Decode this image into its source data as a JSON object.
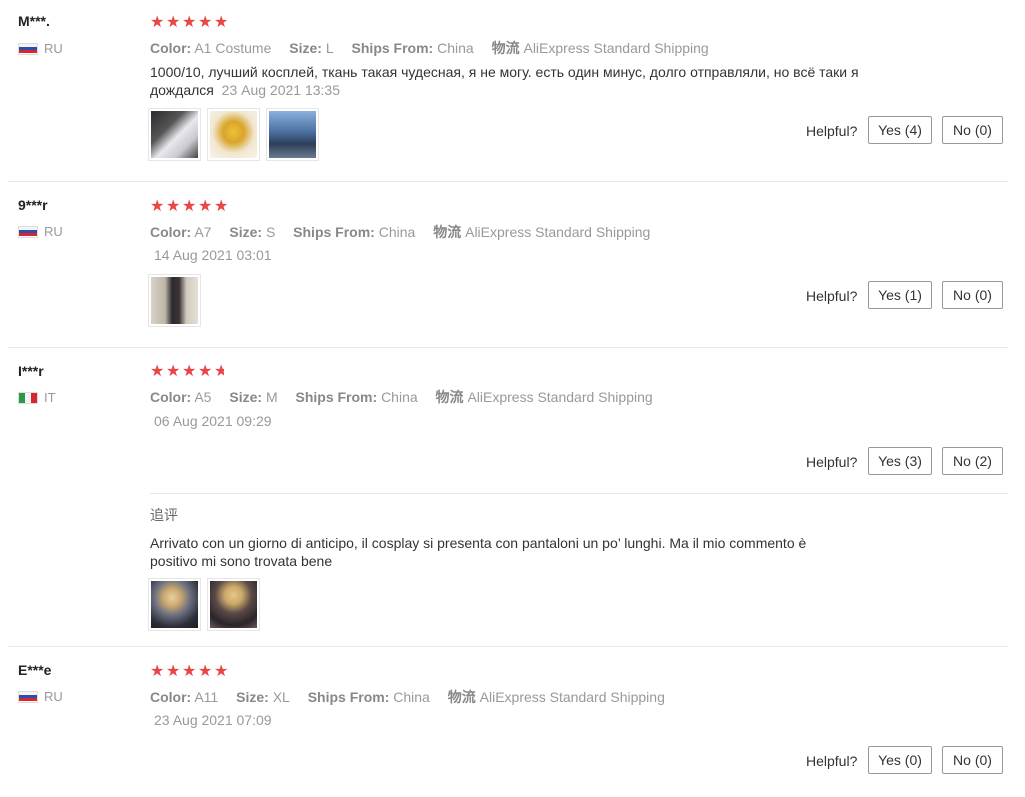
{
  "labels": {
    "color": "Color:",
    "size": "Size:",
    "ships_from": "Ships From:",
    "shipping_label": "物流",
    "helpful": "Helpful?",
    "followup": "追评"
  },
  "star_color": "#e84545",
  "reviews": [
    {
      "user": "M***.",
      "country": "RU",
      "rating": 5,
      "color": "A1 Costume",
      "size": "L",
      "ships_from": "China",
      "shipping": "AliExpress Standard Shipping",
      "text": "1000/10, лучший косплей, ткань такая чудесная, я не могу. есть один минус, долго отправляли, но всё таки я дождался",
      "date": "23 Aug 2021 13:35",
      "yes": "Yes (4)",
      "no": "No (0)"
    },
    {
      "user": "9***r",
      "country": "RU",
      "rating": 5,
      "color": "A7",
      "size": "S",
      "ships_from": "China",
      "shipping": "AliExpress Standard Shipping",
      "date": "14 Aug 2021 03:01",
      "yes": "Yes (1)",
      "no": "No (0)"
    },
    {
      "user": "I***r",
      "country": "IT",
      "rating": 4.7,
      "color": "A5",
      "size": "M",
      "ships_from": "China",
      "shipping": "AliExpress Standard Shipping",
      "date": "06 Aug 2021 09:29",
      "yes": "Yes (3)",
      "no": "No (2)",
      "followup_text": "Arrivato con un giorno di anticipo, il cosplay si presenta con pantaloni un po’ lunghi. Ma il mio commento è positivo mi sono trovata bene"
    },
    {
      "user": "E***e",
      "country": "RU",
      "rating": 5,
      "color": "A11",
      "size": "XL",
      "ships_from": "China",
      "shipping": "AliExpress Standard Shipping",
      "date": "23 Aug 2021 07:09",
      "yes": "Yes (0)",
      "no": "No (0)"
    }
  ]
}
